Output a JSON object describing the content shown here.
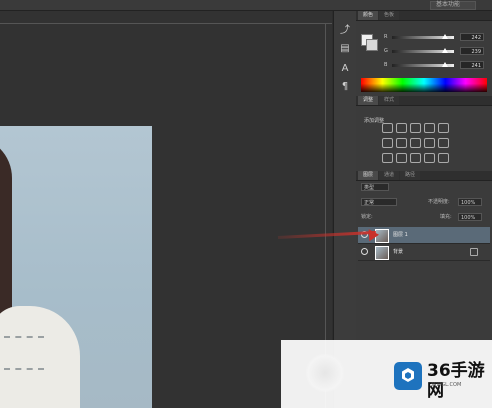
{
  "topbar": {
    "workspace": "基本功能"
  },
  "color_panel": {
    "tabs": [
      "颜色",
      "色板"
    ],
    "sliders": [
      {
        "letter": "R",
        "value": "242"
      },
      {
        "letter": "G",
        "value": "239"
      },
      {
        "letter": "B",
        "value": "241"
      }
    ]
  },
  "adjustments_panel": {
    "tabs": [
      "调整",
      "样式"
    ],
    "title": "添加调整"
  },
  "layers_panel": {
    "tabs": [
      "图层",
      "通道",
      "路径"
    ],
    "filter_kind": "类型",
    "blend_mode": "正常",
    "opacity_label": "不透明度:",
    "opacity_value": "100%",
    "lock_label": "锁定:",
    "fill_label": "填充:",
    "fill_value": "100%",
    "layers": [
      {
        "name": "图层 1",
        "active": true
      },
      {
        "name": "背景",
        "active": false
      }
    ]
  },
  "watermark": {
    "brand": "36手游网",
    "domain": "36WGL.COM"
  },
  "colors": {
    "accent_arrow": "#c9312b",
    "layer_highlight": "#5a6a78",
    "brand_blue": "#1e73be"
  }
}
